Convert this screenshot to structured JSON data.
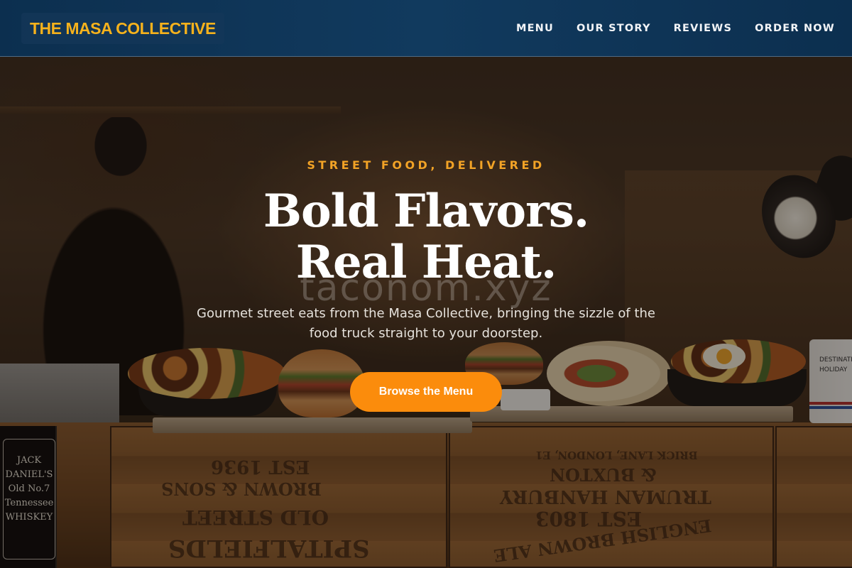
{
  "header": {
    "brand": "THE MASA COLLECTIVE",
    "nav": [
      {
        "label": "MENU"
      },
      {
        "label": "OUR STORY"
      },
      {
        "label": "REVIEWS"
      },
      {
        "label": "ORDER NOW"
      }
    ]
  },
  "hero": {
    "eyebrow": "STREET FOOD, DELIVERED",
    "headline_line1": "Bold Flavors.",
    "headline_line2": "Real Heat.",
    "watermark": "taconom.xyz",
    "subtext": "Gourmet street eats from the Masa Collective, bringing the sizzle of the food truck straight to your doorstep.",
    "cta_label": "Browse the Menu"
  },
  "background_text": {
    "crate_left_year": "EST 1936",
    "crate_left_line1": "BROWN & SONS",
    "crate_left_line2": "OLD STREET",
    "crate_left_line3": "SPITALFIELDS",
    "crate_right_line1": "BRICK LANE, LONDON, E1",
    "crate_right_line2": "& BUXTON",
    "crate_right_line3": "TRUMAN HANBURY",
    "crate_right_year": "EST 1803",
    "crate_right_line4": "ENGLISH BROWN ALE",
    "bottle_label": "JACK DANIEL'S Old No.7 Tennessee WHISKEY",
    "mug_label": "DESTINATION HOLIDAY"
  },
  "colors": {
    "header_bg": "#113a5e",
    "brand": "#f6b21c",
    "eyebrow": "#f2a326",
    "cta_bg": "#fb8c0c",
    "headline": "#ffffff"
  },
  "icons": []
}
